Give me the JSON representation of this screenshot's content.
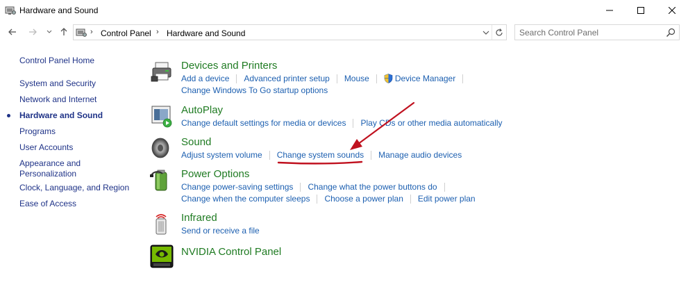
{
  "window": {
    "title": "Hardware and Sound"
  },
  "address": {
    "crumbs": [
      "Control Panel",
      "Hardware and Sound"
    ]
  },
  "search": {
    "placeholder": "Search Control Panel"
  },
  "sidebar": {
    "home": "Control Panel Home",
    "items": [
      "System and Security",
      "Network and Internet",
      "Hardware and Sound",
      "Programs",
      "User Accounts",
      "Appearance and Personalization",
      "Clock, Language, and Region",
      "Ease of Access"
    ],
    "appearance_line1": "Appearance and",
    "appearance_line2": "Personalization",
    "active_index": 2
  },
  "sections": {
    "devices": {
      "title": "Devices and Printers",
      "links": [
        "Add a device",
        "Advanced printer setup",
        "Mouse",
        "Device Manager"
      ],
      "links2": [
        "Change Windows To Go startup options"
      ]
    },
    "autoplay": {
      "title": "AutoPlay",
      "links": [
        "Change default settings for media or devices",
        "Play CDs or other media automatically"
      ]
    },
    "sound": {
      "title": "Sound",
      "links": [
        "Adjust system volume",
        "Change system sounds",
        "Manage audio devices"
      ]
    },
    "power": {
      "title": "Power Options",
      "links": [
        "Change power-saving settings",
        "Change what the power buttons do"
      ],
      "links2": [
        "Change when the computer sleeps",
        "Choose a power plan",
        "Edit power plan"
      ]
    },
    "infrared": {
      "title": "Infrared",
      "links": [
        "Send or receive a file"
      ]
    },
    "nvidia": {
      "title": "NVIDIA Control Panel"
    }
  },
  "colors": {
    "section_title": "#1f7b22",
    "link": "#1c5fb0",
    "sidebar_link": "#1e3287",
    "annotation": "#c0111f"
  },
  "icons": {
    "app": "control-panel-icon",
    "devices": "printer-icon",
    "autoplay": "autoplay-icon",
    "sound": "speaker-icon",
    "power": "battery-icon",
    "infrared": "infrared-icon",
    "nvidia": "nvidia-icon"
  }
}
